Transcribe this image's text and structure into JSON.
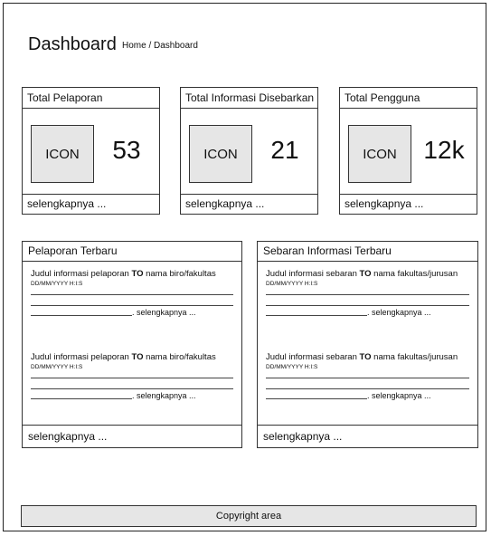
{
  "header": {
    "title": "Dashboard",
    "breadcrumb": "Home / Dashboard"
  },
  "stats": [
    {
      "title": "Total Pelaporan",
      "icon": "ICON",
      "value": "53",
      "more": "selengkapnya ..."
    },
    {
      "title": "Total Informasi Disebarkan",
      "icon": "ICON",
      "value": "21",
      "more": "selengkapnya ..."
    },
    {
      "title": "Total Pengguna",
      "icon": "ICON",
      "value": "12k",
      "more": "selengkapnya ..."
    }
  ],
  "reports": {
    "title": "Pelaporan Terbaru",
    "items": [
      {
        "prefix": "Judul informasi pelaporan ",
        "keyword": "TO",
        "suffix": " nama biro/fakultas",
        "date": "DD/MM/YYYY H:I:S",
        "more": ". selengkapnya ..."
      },
      {
        "prefix": "Judul informasi pelaporan ",
        "keyword": "TO",
        "suffix": " nama biro/fakultas",
        "date": "DD/MM/YYYY H:I:S",
        "more": ". selengkapnya ..."
      }
    ],
    "more": "selengkapnya ..."
  },
  "broadcasts": {
    "title": "Sebaran Informasi Terbaru",
    "items": [
      {
        "prefix": "Judul informasi sebaran ",
        "keyword": "TO",
        "suffix": " nama fakultas/jurusan",
        "date": "DD/MM/YYYY H:I:S",
        "more": ". selengkapnya ..."
      },
      {
        "prefix": "Judul informasi sebaran ",
        "keyword": "TO",
        "suffix": " nama fakultas/jurusan",
        "date": "DD/MM/YYYY H:I:S",
        "more": ". selengkapnya ..."
      }
    ],
    "more": "selengkapnya ..."
  },
  "footer": {
    "text": "Copyright area"
  }
}
